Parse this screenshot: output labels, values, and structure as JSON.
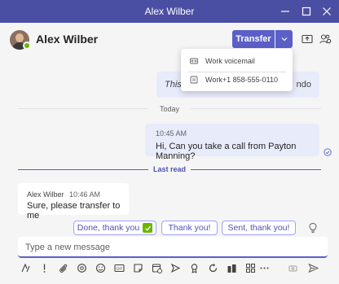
{
  "window": {
    "title": "Alex Wilber"
  },
  "header": {
    "contact_name": "Alex Wilber",
    "transfer_label": "Transfer"
  },
  "transfer_menu": {
    "items": [
      {
        "label": "Work voicemail"
      },
      {
        "label": "Work+1 858-555-0110"
      }
    ]
  },
  "chat": {
    "partial_message": {
      "text_start": "This",
      "text_end": "ndo"
    },
    "day_divider": "Today",
    "sent_message": {
      "time": "10:45 AM",
      "text": "Hi, Can you take a call from Payton Manning?"
    },
    "last_read_label": "Last read",
    "received_message": {
      "sender": "Alex Wilber",
      "time": "10:46 AM",
      "text": "Sure, please transfer to me"
    }
  },
  "suggested_replies": [
    {
      "label": "Done, thank you"
    },
    {
      "label": "Thank you!"
    },
    {
      "label": "Sent, thank you!"
    }
  ],
  "compose": {
    "placeholder": "Type a new message"
  },
  "colors": {
    "titlebar": "#4b4fa3",
    "accent": "#5b5fc7",
    "presence": "#6bb700",
    "sent_bubble": "#e8ebfa"
  },
  "icons": {
    "toolbar": [
      "format-icon",
      "priority-icon",
      "attach-icon",
      "loop-icon",
      "emoji-icon",
      "gif-icon",
      "sticker-icon",
      "schedule-meeting-icon",
      "stream-icon",
      "praise-icon",
      "loop-component-icon",
      "apps-icon",
      "more-options-icon"
    ]
  }
}
